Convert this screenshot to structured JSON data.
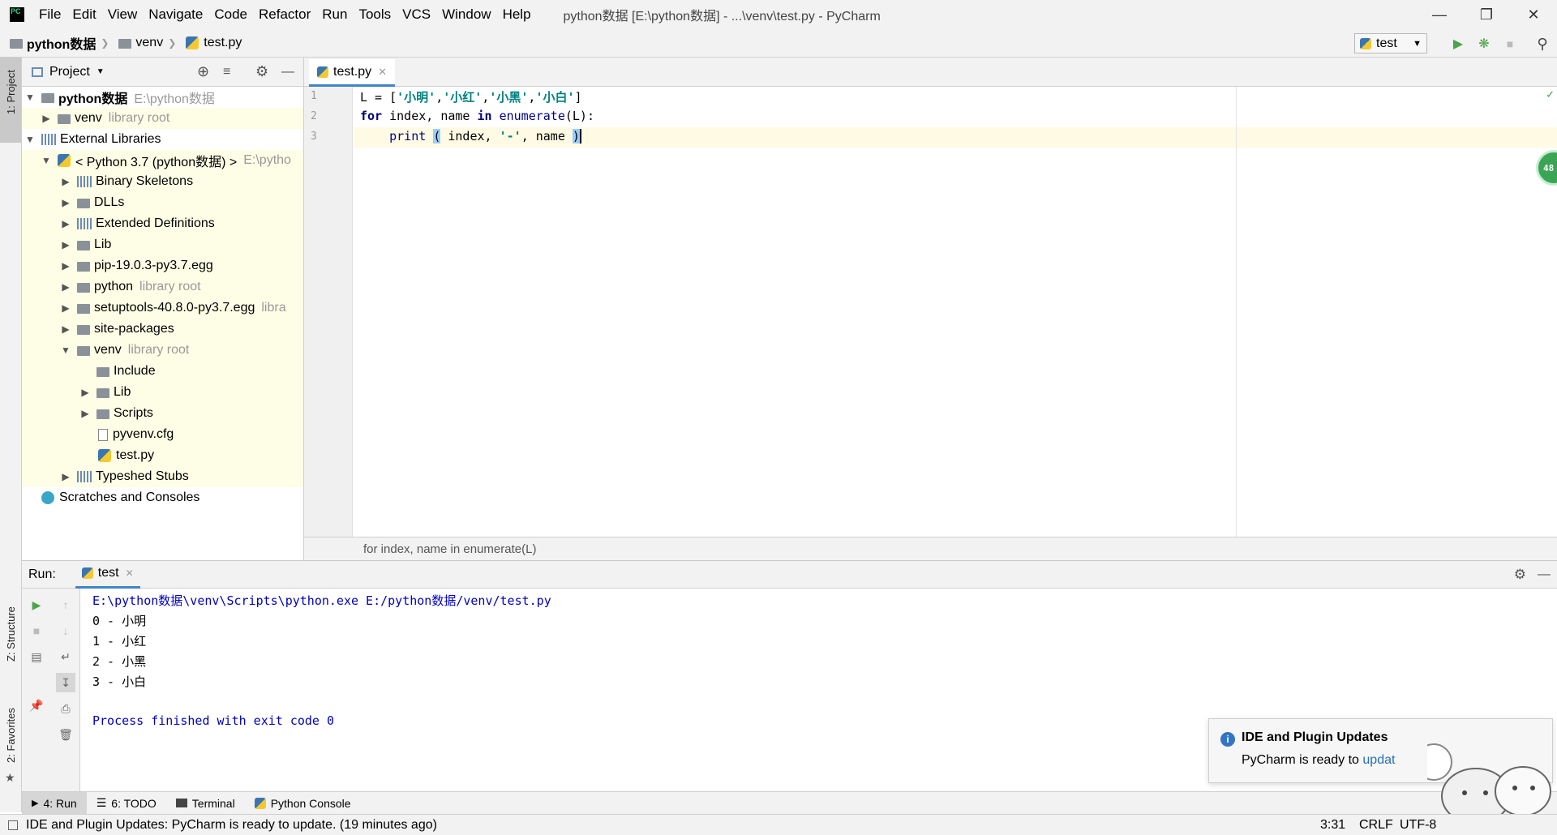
{
  "titlebar": {
    "menu": [
      "File",
      "Edit",
      "View",
      "Navigate",
      "Code",
      "Refactor",
      "Run",
      "Tools",
      "VCS",
      "Window",
      "Help"
    ],
    "title": "python数据 [E:\\python数据] - ...\\venv\\test.py - PyCharm"
  },
  "navbar": {
    "crumbs": [
      "python数据",
      "venv",
      "test.py"
    ],
    "run_config": "test"
  },
  "side_tabs": {
    "project": "1: Project",
    "structure": "Z: Structure",
    "favorites": "2: Favorites"
  },
  "project": {
    "header": "Project",
    "tree": [
      {
        "label": "python数据",
        "note": "E:\\python数据"
      },
      {
        "label": "venv",
        "note": "library root"
      },
      {
        "label": "External Libraries",
        "note": ""
      },
      {
        "label": "< Python 3.7 (python数据) >",
        "note": "E:\\pytho"
      },
      {
        "label": "Binary Skeletons",
        "note": ""
      },
      {
        "label": "DLLs",
        "note": ""
      },
      {
        "label": "Extended Definitions",
        "note": ""
      },
      {
        "label": "Lib",
        "note": ""
      },
      {
        "label": "pip-19.0.3-py3.7.egg",
        "note": ""
      },
      {
        "label": "python",
        "note": "library root"
      },
      {
        "label": "setuptools-40.8.0-py3.7.egg",
        "note": "libra"
      },
      {
        "label": "site-packages",
        "note": ""
      },
      {
        "label": "venv",
        "note": "library root"
      },
      {
        "label": "Include",
        "note": ""
      },
      {
        "label": "Lib",
        "note": ""
      },
      {
        "label": "Scripts",
        "note": ""
      },
      {
        "label": "pyvenv.cfg",
        "note": ""
      },
      {
        "label": "test.py",
        "note": ""
      },
      {
        "label": "Typeshed Stubs",
        "note": ""
      },
      {
        "label": "Scratches and Consoles",
        "note": ""
      }
    ]
  },
  "editor": {
    "tab": "test.py",
    "line_numbers": [
      "1",
      "2",
      "3"
    ],
    "breadcrumb": "for index, name in enumerate(L)",
    "badge": "48"
  },
  "run": {
    "label": "Run:",
    "tab": "test",
    "console": [
      "E:\\python数据\\venv\\Scripts\\python.exe E:/python数据/venv/test.py",
      "0 - 小明",
      "1 - 小红",
      "2 - 小黑",
      "3 - 小白",
      "",
      "Process finished with exit code 0"
    ]
  },
  "tool_tabs": [
    "4: Run",
    "6: TODO",
    "Terminal",
    "Python Console"
  ],
  "notification": {
    "title": "IDE and Plugin Updates",
    "body": "PyCharm is ready to ",
    "link": "updat"
  },
  "status": {
    "message": "IDE and Plugin Updates: PyCharm is ready to update. (19 minutes ago)",
    "position": "3:31",
    "line_sep": "CRLF",
    "encoding": "UTF-8"
  },
  "colors": {
    "accent": "#4083c9",
    "run_green": "#4ca34c",
    "badge_green": "#3aa655"
  }
}
